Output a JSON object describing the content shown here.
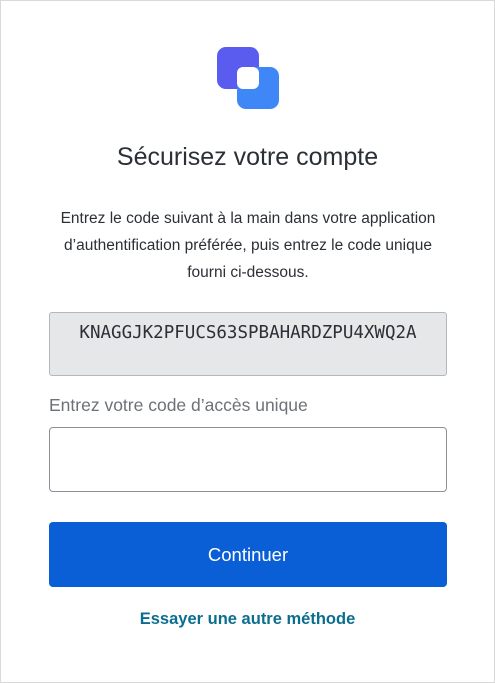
{
  "logo": {
    "icon": "brand-logo-icon",
    "colors": {
      "primary": "#4f64f0",
      "secondary": "#3d86f5"
    }
  },
  "title": "Sécurisez votre compte",
  "description": "Entrez le code suivant à la main dans votre application d’authentification préférée, puis entrez le code unique fourni ci-dessous.",
  "secret_key": "KNAGGJK2PFUCS63SPBAHARDZPU4XWQ2A",
  "code_field": {
    "label": "Entrez votre code d’accès unique",
    "value": ""
  },
  "continue_button": {
    "label": "Continuer",
    "color": "#0b5fd6"
  },
  "alt_method_link": {
    "label": "Essayer une autre méthode",
    "color": "#0b6e8f"
  }
}
